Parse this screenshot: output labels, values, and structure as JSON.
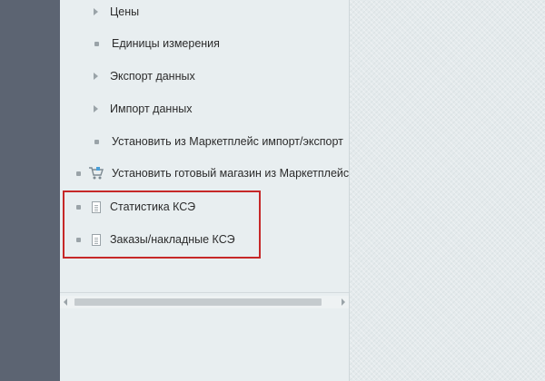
{
  "menu": {
    "prices": "Цены",
    "units": "Единицы измерения",
    "export": "Экспорт данных",
    "import": "Импорт данных",
    "marketplace_import_export": "Установить из Маркетплейс импорт/экспорт",
    "install_shop": "Установить готовый магазин из Маркетплейс",
    "kse_stats": "Статистика КСЭ",
    "kse_orders": "Заказы/накладные КСЭ"
  },
  "colors": {
    "highlight": "#c62828",
    "sidebar_dark": "#5c6472"
  },
  "icons": {
    "cart": "shopping-cart-icon",
    "document": "document-icon"
  }
}
